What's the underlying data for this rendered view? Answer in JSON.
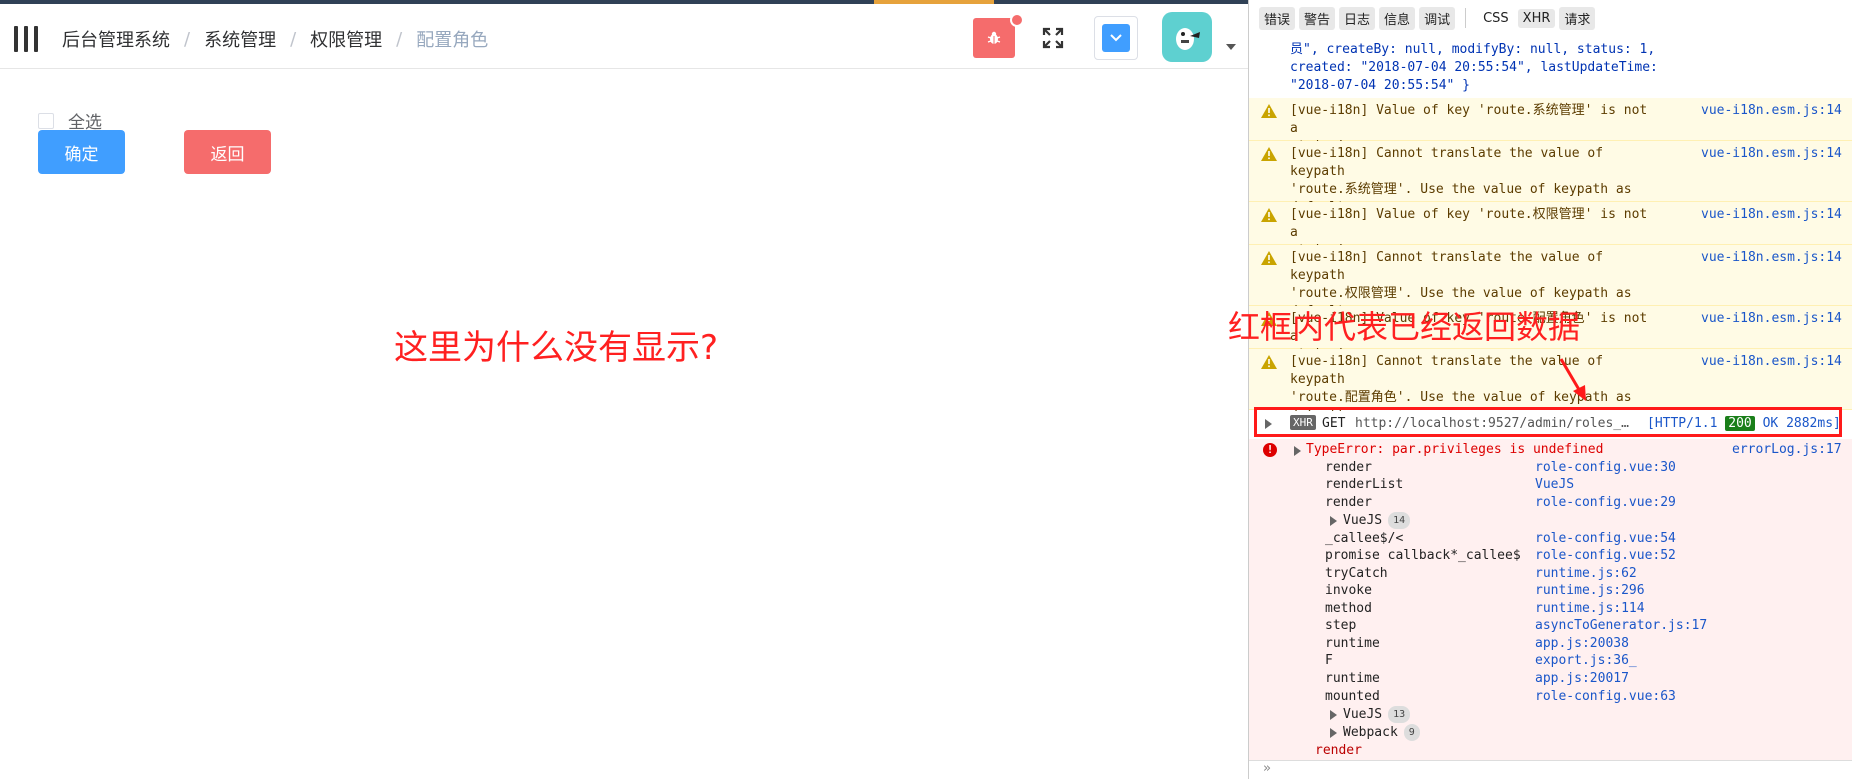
{
  "breadcrumb": {
    "items": [
      "后台管理系统",
      "系统管理",
      "权限管理"
    ],
    "current": "配置角色",
    "separator": "/"
  },
  "main": {
    "checkall_label": "全选",
    "confirm_label": "确定",
    "back_label": "返回"
  },
  "annotations": {
    "left": "这里为什么没有显示?",
    "right": "红框内代表已经返回数据"
  },
  "devtools": {
    "tabs": [
      "错误",
      "警告",
      "日志",
      "信息",
      "调试"
    ],
    "tabs2": [
      "CSS",
      "XHR",
      "请求"
    ],
    "object_lines": [
      "员\", createBy: null, modifyBy: null, status: 1,",
      "created: \"2018-07-04 20:55:54\", lastUpdateTime:",
      "\"2018-07-04 20:55:54\" }"
    ],
    "warnings": [
      {
        "msg": "[vue-i18n] Value of key 'route.系统管理' is not a\nstring!",
        "src": "vue-i18n.esm.js:14"
      },
      {
        "msg": "[vue-i18n] Cannot translate the value of keypath\n'route.系统管理'. Use the value of keypath as\ndefault.",
        "src": "vue-i18n.esm.js:14"
      },
      {
        "msg": "[vue-i18n] Value of key 'route.权限管理' is not a\nstring!",
        "src": "vue-i18n.esm.js:14"
      },
      {
        "msg": "[vue-i18n] Cannot translate the value of keypath\n'route.权限管理'. Use the value of keypath as\ndefault.",
        "src": "vue-i18n.esm.js:14"
      },
      {
        "msg": "[vue-i18n] Value of key 'route.配置角色' is not a\nstring!",
        "src": "vue-i18n.esm.js:14"
      },
      {
        "msg": "[vue-i18n] Cannot translate the value of keypath\n'route.配置角色'. Use the value of keypath as\ndefault.",
        "src": "vue-i18n.esm.js:14"
      }
    ],
    "xhr": {
      "badge": "XHR",
      "method": "GET",
      "url": "http://localhost:9527/admin/roles_…",
      "status_prefix": "[HTTP/1.1",
      "status_code": "200",
      "status_suffix": "OK 2882ms]"
    },
    "error": {
      "title": "TypeError: par.privileges is undefined",
      "src": "errorLog.js:17",
      "frames": [
        {
          "fn": "render",
          "src": "role-config.vue:30"
        },
        {
          "fn": "renderList",
          "src": "VueJS"
        },
        {
          "fn": "render",
          "src": "role-config.vue:29"
        },
        {
          "group": "VueJS",
          "count": "14"
        },
        {
          "fn": "_callee$/<",
          "src": "role-config.vue:54"
        },
        {
          "fn": "promise callback*_callee$",
          "src": "role-config.vue:52"
        },
        {
          "fn": "tryCatch",
          "src": "runtime.js:62"
        },
        {
          "fn": "invoke",
          "src": "runtime.js:296"
        },
        {
          "fn": "method",
          "src": "runtime.js:114"
        },
        {
          "fn": "step",
          "src": "asyncToGenerator.js:17"
        },
        {
          "fn": "runtime",
          "src": "app.js:20038"
        },
        {
          "fn": "F",
          "src": "export.js:36_"
        },
        {
          "fn": "runtime",
          "src": "app.js:20017"
        },
        {
          "fn": "mounted",
          "src": "role-config.vue:63"
        },
        {
          "group": "VueJS",
          "count": "13"
        },
        {
          "group": "Webpack",
          "count": "9"
        }
      ],
      "last": "render"
    },
    "prompt": "»"
  },
  "colors": {
    "primary": "#409eff",
    "danger": "#f56c6c",
    "annotation": "#ff2020",
    "navbar_dark": "#304156"
  }
}
